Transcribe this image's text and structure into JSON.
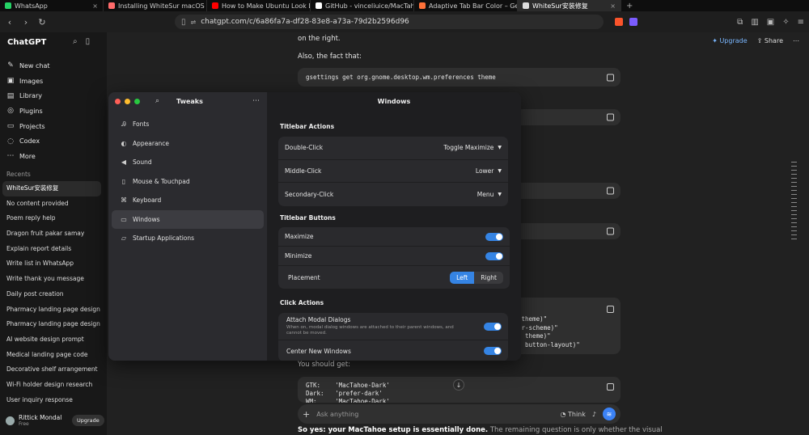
{
  "tabs": [
    {
      "label": "WhatsApp",
      "color": "#25d366"
    },
    {
      "label": "Installing WhiteSur macOS U",
      "color": "#ff6b6b"
    },
    {
      "label": "How to Make Ubuntu Look Li",
      "color": "#ff0000"
    },
    {
      "label": "GitHub - vinceliuice/MacTaho",
      "color": "#ffffff"
    },
    {
      "label": "Adaptive Tab Bar Color – Get",
      "color": "#ff7139"
    },
    {
      "label": "WhiteSur安装修复",
      "color": "#dddddd",
      "active": true
    }
  ],
  "url": "chatgpt.com/c/6a86fa7a-df28-83e8-a73a-79d2b2596d96",
  "sidebar": {
    "brand": "ChatGPT",
    "nav": [
      {
        "label": "New chat",
        "icon": "edit-icon",
        "glyph": "✎"
      },
      {
        "label": "Images",
        "icon": "image-icon",
        "glyph": "▣"
      },
      {
        "label": "Library",
        "icon": "library-icon",
        "glyph": "▤"
      },
      {
        "label": "Plugins",
        "icon": "plugins-icon",
        "glyph": "◎"
      },
      {
        "label": "Projects",
        "icon": "folder-icon",
        "glyph": "▭"
      },
      {
        "label": "Codex",
        "icon": "codex-icon",
        "glyph": "◌"
      },
      {
        "label": "More",
        "icon": "more-icon",
        "glyph": "⋯"
      }
    ],
    "recents_label": "Recents",
    "recents": [
      "WhiteSur安装修复",
      "No content provided",
      "Poem reply help",
      "Dragon fruit pakar samay",
      "Explain report details",
      "Write list in WhatsApp",
      "Write thank you message",
      "Daily post creation",
      "Pharmacy landing page design",
      "Pharmacy landing page design",
      "AI website design prompt",
      "Medical landing page code",
      "Decorative shelf arrangement",
      "Wi-Fi holder design research",
      "User inquiry response"
    ],
    "user_name": "Rittick Mondal",
    "user_plan": "Free",
    "upgrade": "Upgrade"
  },
  "main": {
    "upgrade": "Upgrade",
    "share": "Share",
    "para1": "on the right.",
    "para2": "Also, the fact that:",
    "code1": "gsettings get org.gnome.desktop.wm.preferences theme",
    "code_partial": [
      "-theme)\"",
      "or-scheme)\"",
      "s theme)\"",
      "s button-layout)\""
    ],
    "para3": "You should get:",
    "code_result": [
      "GTK:    'MacTahoe-Dark'",
      "Dark:   'prefer-dark'",
      "WM:     'MacTahoe-Dark'"
    ],
    "composer_placeholder": "Ask anything",
    "think": "Think",
    "bottom_bold": "So yes: your MacTahoe setup is essentially done.",
    "bottom_rest": " The remaining question is only whether the visual"
  },
  "tweaks": {
    "title": "Tweaks",
    "nav": [
      {
        "label": "Fonts",
        "icon": "fonts-icon",
        "glyph": "Ꭿ"
      },
      {
        "label": "Appearance",
        "icon": "appearance-icon",
        "glyph": "◐"
      },
      {
        "label": "Sound",
        "icon": "sound-icon",
        "glyph": "◀"
      },
      {
        "label": "Mouse & Touchpad",
        "icon": "mouse-icon",
        "glyph": "▯"
      },
      {
        "label": "Keyboard",
        "icon": "keyboard-icon",
        "glyph": "⌘"
      },
      {
        "label": "Windows",
        "icon": "windows-icon",
        "glyph": "▭",
        "active": true
      },
      {
        "label": "Startup Applications",
        "icon": "startup-icon",
        "glyph": "▱"
      }
    ],
    "panel_title": "Windows",
    "titlebar_actions": "Titlebar Actions",
    "double_click": "Double-Click",
    "double_click_val": "Toggle Maximize",
    "middle_click": "Middle-Click",
    "middle_click_val": "Lower",
    "secondary_click": "Secondary-Click",
    "secondary_click_val": "Menu",
    "titlebar_buttons": "Titlebar Buttons",
    "maximize": "Maximize",
    "minimize": "Minimize",
    "placement": "Placement",
    "left": "Left",
    "right": "Right",
    "click_actions": "Click Actions",
    "attach_modal": "Attach Modal Dialogs",
    "attach_modal_sub": "When on, modal dialog windows are attached to their parent windows, and cannot be moved.",
    "center_new": "Center New Windows"
  }
}
